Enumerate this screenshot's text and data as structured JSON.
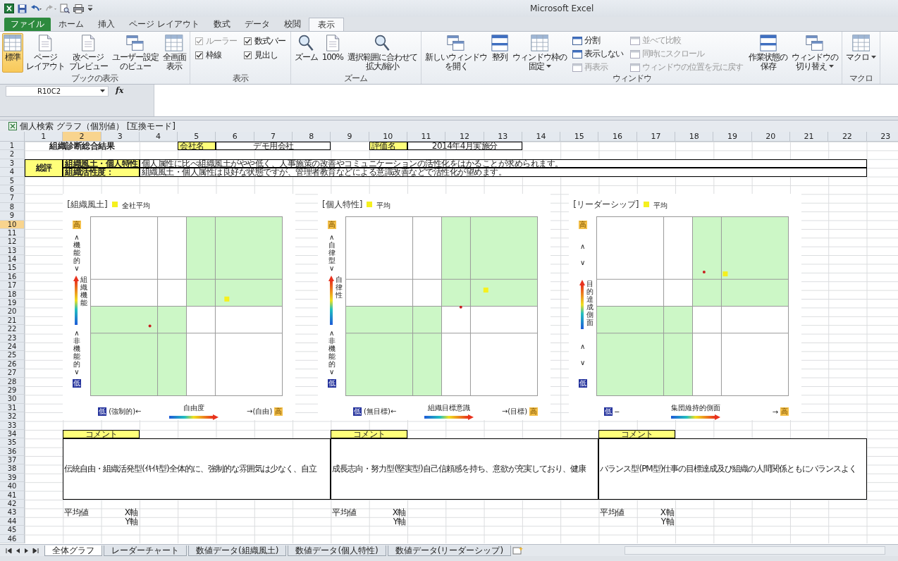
{
  "window": {
    "title": "Microsoft Excel"
  },
  "ribbon": {
    "tabs": [
      {
        "label": "ファイル",
        "kind": "file",
        "selected": false
      },
      {
        "label": "ホーム",
        "kind": "tab",
        "selected": false
      },
      {
        "label": "挿入",
        "kind": "tab",
        "selected": false
      },
      {
        "label": "ページ レイアウト",
        "kind": "tab",
        "selected": false
      },
      {
        "label": "数式",
        "kind": "tab",
        "selected": false
      },
      {
        "label": "データ",
        "kind": "tab",
        "selected": false
      },
      {
        "label": "校閲",
        "kind": "tab",
        "selected": false
      },
      {
        "label": "表示",
        "kind": "tab",
        "selected": true
      }
    ],
    "groups": [
      {
        "label": "ブックの表示",
        "items": [
          {
            "kind": "large",
            "label": [
              "標準"
            ],
            "selected": true,
            "dropdown": false
          },
          {
            "kind": "large",
            "label": [
              "ページ",
              "レイアウト"
            ],
            "selected": false,
            "dropdown": false
          },
          {
            "kind": "large",
            "label": [
              "改ページ",
              "プレビュー"
            ],
            "selected": false,
            "dropdown": false
          },
          {
            "kind": "large",
            "label": [
              "ユーザー設定",
              "のビュー"
            ],
            "selected": false,
            "dropdown": false
          },
          {
            "kind": "large",
            "label": [
              "全画面",
              "表示"
            ],
            "selected": false,
            "dropdown": false
          }
        ]
      },
      {
        "label": "表示",
        "items": [
          {
            "kind": "stack",
            "items": [
              {
                "kind": "check",
                "label": "ルーラー",
                "checked": true,
                "disabled": true
              },
              {
                "kind": "check",
                "label": "枠線",
                "checked": true,
                "disabled": false
              }
            ]
          },
          {
            "kind": "stack",
            "items": [
              {
                "kind": "check",
                "label": "数式バー",
                "checked": true,
                "disabled": false
              },
              {
                "kind": "check",
                "label": "見出し",
                "checked": true,
                "disabled": false
              }
            ]
          }
        ]
      },
      {
        "label": "ズーム",
        "items": [
          {
            "kind": "large",
            "label": [
              "ズーム"
            ],
            "selected": false,
            "dropdown": false
          },
          {
            "kind": "large",
            "label": [
              "100%"
            ],
            "selected": false,
            "dropdown": false
          },
          {
            "kind": "large",
            "label": [
              "選択範囲に合わせて",
              "拡大/縮小"
            ],
            "selected": false,
            "dropdown": false
          }
        ]
      },
      {
        "label": "ウィンドウ",
        "items": [
          {
            "kind": "large",
            "label": [
              "新しいウィンドウ",
              "を開く"
            ],
            "selected": false,
            "dropdown": false
          },
          {
            "kind": "large",
            "label": [
              "整列"
            ],
            "selected": false,
            "dropdown": false
          },
          {
            "kind": "large",
            "label": [
              "ウィンドウ枠の",
              "固定"
            ],
            "selected": false,
            "dropdown": true
          },
          {
            "kind": "stack",
            "items": [
              {
                "kind": "small",
                "label": "分割",
                "disabled": false
              },
              {
                "kind": "small",
                "label": "表示しない",
                "disabled": false
              },
              {
                "kind": "small",
                "label": "再表示",
                "disabled": true
              }
            ]
          },
          {
            "kind": "stack",
            "items": [
              {
                "kind": "small",
                "label": "並べて比較",
                "disabled": true
              },
              {
                "kind": "small",
                "label": "同時にスクロール",
                "disabled": true
              },
              {
                "kind": "small",
                "label": "ウィンドウの位置を元に戻す",
                "disabled": true
              }
            ]
          },
          {
            "kind": "large",
            "label": [
              "作業状態の",
              "保存"
            ],
            "selected": false,
            "dropdown": false
          },
          {
            "kind": "large",
            "label": [
              "ウィンドウの",
              "切り替え"
            ],
            "selected": false,
            "dropdown": true
          }
        ]
      },
      {
        "label": "マクロ",
        "items": [
          {
            "kind": "large",
            "label": [
              "マクロ"
            ],
            "selected": false,
            "dropdown": true
          }
        ]
      }
    ]
  },
  "formula_bar": {
    "name_box": "R10C2",
    "function_label": "fx"
  },
  "workbook": {
    "title": "個人検索 グラフ（個別値）  [互換モード]"
  },
  "sheet": {
    "columns": [
      {
        "label": "1",
        "selected": false
      },
      {
        "label": "2",
        "selected": true
      },
      {
        "label": "3",
        "selected": false
      },
      {
        "label": "4",
        "selected": false
      },
      {
        "label": "5",
        "selected": false
      },
      {
        "label": "6",
        "selected": false
      },
      {
        "label": "7",
        "selected": false
      },
      {
        "label": "8",
        "selected": false
      },
      {
        "label": "9",
        "selected": false
      },
      {
        "label": "10",
        "selected": false
      },
      {
        "label": "11",
        "selected": false
      },
      {
        "label": "12",
        "selected": false
      },
      {
        "label": "13",
        "selected": false
      },
      {
        "label": "14",
        "selected": false
      },
      {
        "label": "15",
        "selected": false
      },
      {
        "label": "16",
        "selected": false
      },
      {
        "label": "17",
        "selected": false
      },
      {
        "label": "18",
        "selected": false
      },
      {
        "label": "19",
        "selected": false
      },
      {
        "label": "20",
        "selected": false
      },
      {
        "label": "21",
        "selected": false
      },
      {
        "label": "22",
        "selected": false
      },
      {
        "label": "23",
        "selected": false
      }
    ],
    "rows": [
      {
        "label": "1",
        "selected": false
      },
      {
        "label": "2",
        "selected": false
      },
      {
        "label": "3",
        "selected": false
      },
      {
        "label": "4",
        "selected": false
      },
      {
        "label": "5",
        "selected": false
      },
      {
        "label": "6",
        "selected": false
      },
      {
        "label": "7",
        "selected": false
      },
      {
        "label": "8",
        "selected": false
      },
      {
        "label": "9",
        "selected": false
      },
      {
        "label": "10",
        "selected": true
      },
      {
        "label": "11",
        "selected": false
      },
      {
        "label": "12",
        "selected": false
      },
      {
        "label": "13",
        "selected": false
      },
      {
        "label": "14",
        "selected": false
      },
      {
        "label": "15",
        "selected": false
      },
      {
        "label": "16",
        "selected": false
      },
      {
        "label": "17",
        "selected": false
      },
      {
        "label": "18",
        "selected": false
      },
      {
        "label": "19",
        "selected": false
      },
      {
        "label": "20",
        "selected": false
      },
      {
        "label": "21",
        "selected": false
      },
      {
        "label": "22",
        "selected": false
      },
      {
        "label": "23",
        "selected": false
      },
      {
        "label": "24",
        "selected": false
      },
      {
        "label": "25",
        "selected": false
      },
      {
        "label": "26",
        "selected": false
      },
      {
        "label": "27",
        "selected": false
      },
      {
        "label": "28",
        "selected": false
      },
      {
        "label": "29",
        "selected": false
      },
      {
        "label": "30",
        "selected": false
      },
      {
        "label": "31",
        "selected": false
      },
      {
        "label": "32",
        "selected": false
      },
      {
        "label": "33",
        "selected": false
      },
      {
        "label": "34",
        "selected": false
      },
      {
        "label": "35",
        "selected": false
      },
      {
        "label": "36",
        "selected": false
      },
      {
        "label": "37",
        "selected": false
      },
      {
        "label": "38",
        "selected": false
      },
      {
        "label": "39",
        "selected": false
      },
      {
        "label": "40",
        "selected": false
      },
      {
        "label": "41",
        "selected": false
      },
      {
        "label": "42",
        "selected": false
      },
      {
        "label": "43",
        "selected": false
      },
      {
        "label": "44",
        "selected": false
      },
      {
        "label": "45",
        "selected": false
      },
      {
        "label": "46",
        "selected": false
      }
    ],
    "header": {
      "title": "組織診断総合結果",
      "company_label": "会社名",
      "company": "デモ用会社",
      "evaluation_label": "評価名",
      "evaluation": "2014年4月実施分"
    },
    "summary": {
      "label": "総評",
      "rows": [
        {
          "label": "組織風土・個人特性",
          "text": "個人属性に比べ組織風土がやや低く、人事施策の改善やコミュニケーションの活性化をはかることが求められます。"
        },
        {
          "label": "組織活性度：",
          "text": "組織風土・個人属性は良好な状態ですが、管理者教育などによる意識改善などで活性化が望めます。"
        }
      ]
    },
    "charts": [
      {
        "title": "[組織風土]",
        "legend": "全社平均",
        "y_high": "高",
        "y_top": [
          "∧機能的∨"
        ],
        "y_axis": "組織機能",
        "y_bottom": [
          "∧非機能的∨"
        ],
        "y_low": "低",
        "x_low": "低",
        "x_left": "(強制的)←",
        "x_axis": "自由度",
        "x_right": "→(自由)",
        "x_high": "高"
      },
      {
        "title": "[個人特性]",
        "legend": "平均",
        "y_high": "高",
        "y_top": [
          "∧自律型∨"
        ],
        "y_axis": "自律性",
        "y_bottom": [
          "∧非機能的∨"
        ],
        "y_low": "低",
        "x_low": "低",
        "x_left": "(無目標)←",
        "x_axis": "組織目標意識",
        "x_right": "→(目標)",
        "x_high": "高"
      },
      {
        "title": "[リーダーシップ]",
        "legend": "平均",
        "y_high": "高",
        "y_top": [
          "∧",
          "∨"
        ],
        "y_axis": "目的達成側面",
        "y_bottom": [
          "∧",
          "∨"
        ],
        "y_low": "低",
        "x_low": "低",
        "x_left": "─",
        "x_axis": "集団維持的側面",
        "x_right": "→",
        "x_high": "高"
      }
    ],
    "comments": [
      {
        "header": "コメント",
        "text": "伝統自由・組織活発型(ｲｷｲｷ型)全体的に、強制的な雰囲気は少なく、自立",
        "average_label": "平均値",
        "x_label": "X軸",
        "y_label": "Y軸"
      },
      {
        "header": "コメント",
        "text": "成長志向・努力型(堅実型)自己信頼感を持ち、意欲が充実しており、健康",
        "average_label": "平均値",
        "x_label": "X軸",
        "y_label": "Y軸"
      },
      {
        "header": "コメント",
        "text": "バランス型(PM型)仕事の目標達成及び組織の人間関係ともにバランスよく",
        "average_label": "平均値",
        "x_label": "X軸",
        "y_label": "Y軸"
      }
    ]
  },
  "sheet_tabs": [
    {
      "label": "全体グラフ",
      "selected": true
    },
    {
      "label": "レーダーチャート",
      "selected": false
    },
    {
      "label": "数値データ(組織風土)",
      "selected": false
    },
    {
      "label": "数値データ(個人特性)",
      "selected": false
    },
    {
      "label": "数値データ(リーダーシップ)",
      "selected": false
    }
  ]
}
